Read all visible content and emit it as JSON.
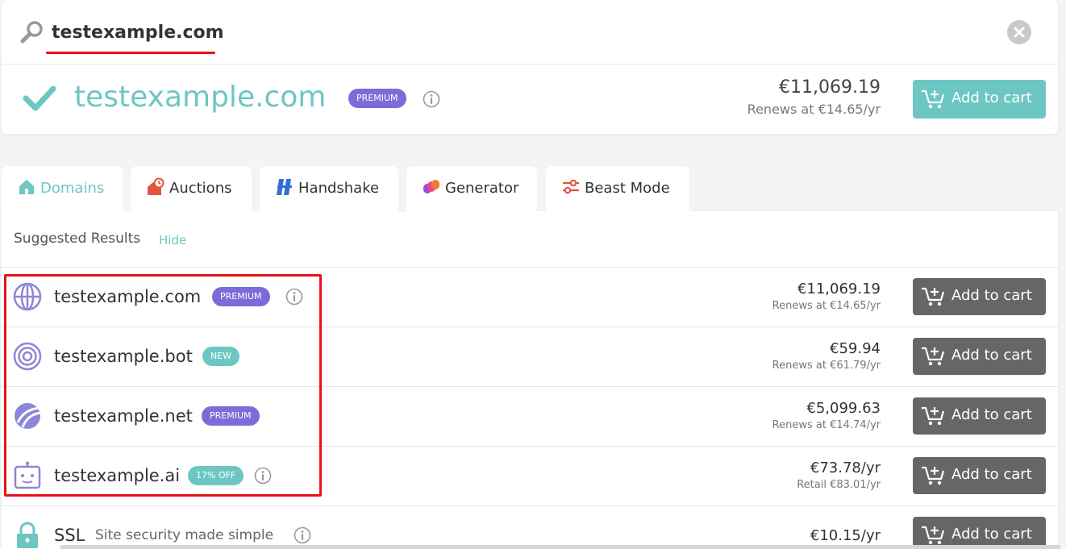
{
  "search": {
    "query": "testexample.com",
    "placeholder": ""
  },
  "hero": {
    "domain": "testexample.com",
    "badge": "PREMIUM",
    "price": "€11,069.19",
    "renew": "Renews at €14.65/yr",
    "cart_label": "Add to cart"
  },
  "tabs": [
    {
      "label": "Domains",
      "icon": "home-icon",
      "active": true
    },
    {
      "label": "Auctions",
      "icon": "auction-icon",
      "active": false
    },
    {
      "label": "Handshake",
      "icon": "handshake-icon",
      "active": false
    },
    {
      "label": "Generator",
      "icon": "generator-icon",
      "active": false
    },
    {
      "label": "Beast Mode",
      "icon": "sliders-icon",
      "active": false
    }
  ],
  "results": {
    "title": "Suggested Results",
    "hide_label": "Hide",
    "rows": [
      {
        "domain": "testexample.com",
        "badge": "PREMIUM",
        "icon": "globe-icon",
        "price": "€11,069.19",
        "renew": "Renews at €14.65/yr",
        "cart_label": "Add to cart"
      },
      {
        "domain": "testexample.bot",
        "badge": "NEW",
        "icon": "target-icon",
        "price": "€59.94",
        "renew": "Renews at €61.79/yr",
        "cart_label": "Add to cart"
      },
      {
        "domain": "testexample.net",
        "badge": "PREMIUM",
        "icon": "net-icon",
        "price": "€5,099.63",
        "renew": "Renews at €14.74/yr",
        "cart_label": "Add to cart"
      },
      {
        "domain": "testexample.ai",
        "badge": "17% OFF",
        "icon": "robot-icon",
        "price": "€73.78/yr",
        "renew": "Retail €83.01/yr",
        "cart_label": "Add to cart"
      }
    ],
    "ssl": {
      "name": "SSL",
      "tagline": "Site security made simple",
      "icon": "lock-icon",
      "price": "€10.15/yr",
      "cart_label": "Add to cart"
    }
  },
  "colors": {
    "teal": "#6cc7c3",
    "premium": "#7b6cd9",
    "cart_dark": "#666666",
    "highlight": "#e8101a"
  }
}
